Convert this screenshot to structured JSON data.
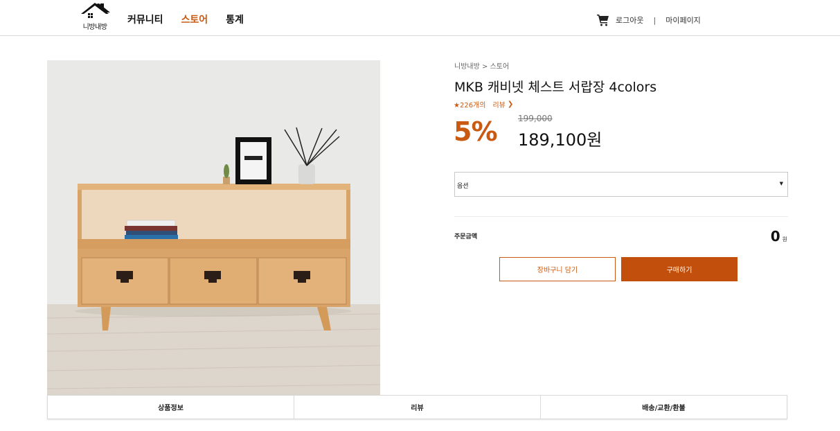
{
  "header": {
    "logo_text": "니방내방",
    "nav": [
      {
        "label": "커뮤니티"
      },
      {
        "label": "스토어"
      },
      {
        "label": "통계"
      }
    ],
    "active_nav": "스토어",
    "logout_label": "로그아웃",
    "separator": "|",
    "mypage_label": "마이페이지",
    "accent_color": "#c95a12"
  },
  "breadcrumb": {
    "home": "니방내방",
    "sep": ">",
    "current": "스토어"
  },
  "product": {
    "title": "MKB 캐비넷 체스트 서랍장 4colors",
    "review_count": "★226개의",
    "review_label": "리뷰",
    "review_arrow": "❯",
    "discount": "5%",
    "original_price": "199,000",
    "sale_price": "189,100원"
  },
  "option": {
    "label": "옵션",
    "arrow": "▼"
  },
  "order": {
    "total_label": "주문금액",
    "total_value": "0",
    "total_unit": "원"
  },
  "buttons": {
    "cart": "장바구니 담기",
    "buy": "구매하기"
  },
  "tabs": [
    {
      "label": "상품정보"
    },
    {
      "label": "리뷰"
    },
    {
      "label": "배송/교환/환불"
    }
  ]
}
